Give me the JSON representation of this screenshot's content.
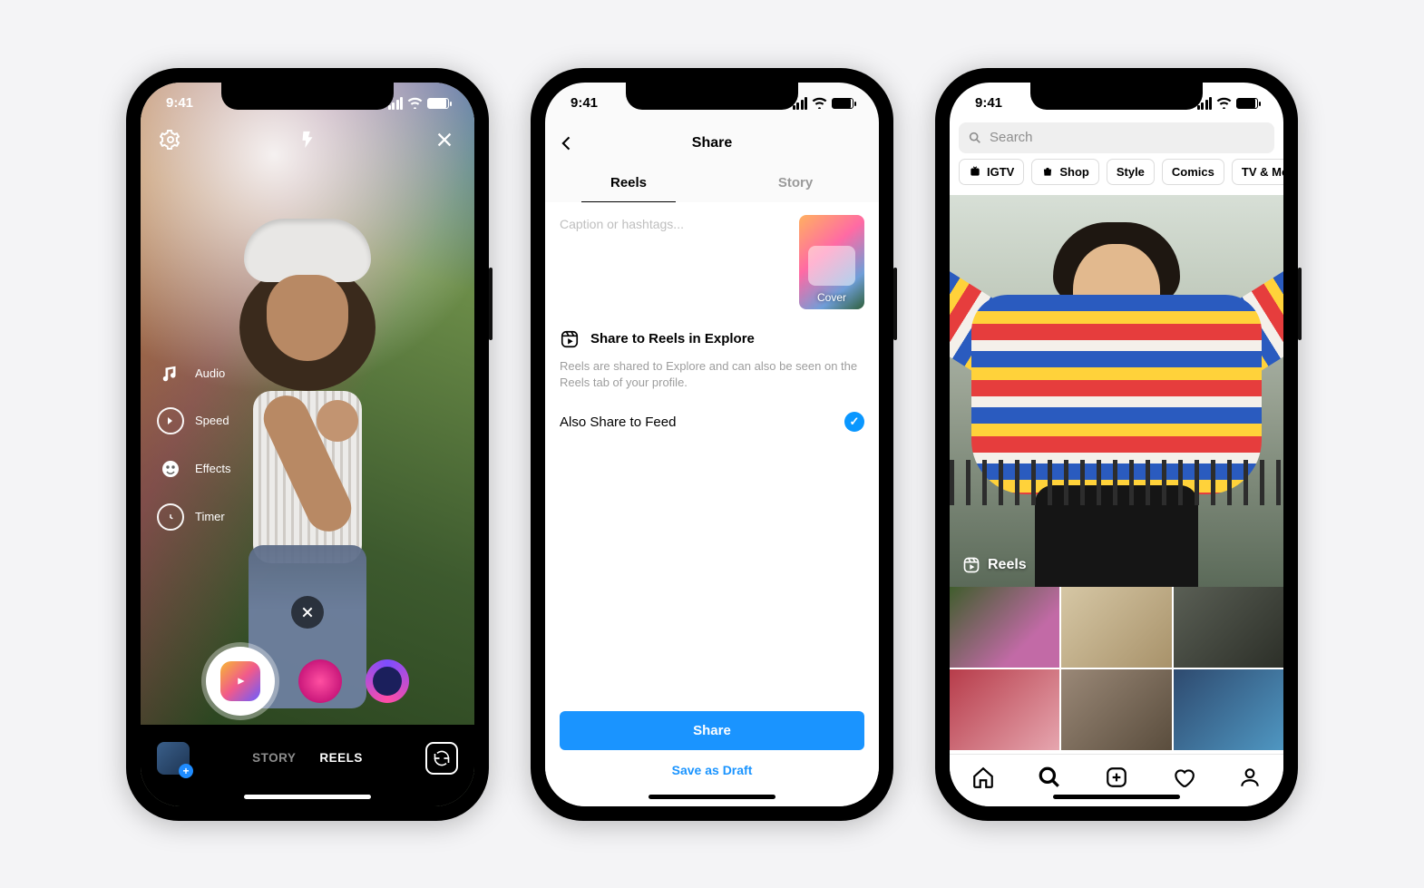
{
  "status": {
    "time": "9:41"
  },
  "phone1": {
    "tools": {
      "audio": "Audio",
      "speed": "Speed",
      "effects": "Effects",
      "timer": "Timer"
    },
    "modes": {
      "story": "STORY",
      "reels": "REELS"
    }
  },
  "phone2": {
    "header": {
      "title": "Share"
    },
    "tabs": {
      "reels": "Reels",
      "story": "Story"
    },
    "caption_placeholder": "Caption or hashtags...",
    "cover_label": "Cover",
    "share_reels_title": "Share to Reels in Explore",
    "share_reels_desc": "Reels are shared to Explore and can also be seen on the Reels tab of your profile.",
    "also_feed": "Also Share to Feed",
    "share_btn": "Share",
    "draft_btn": "Save as Draft"
  },
  "phone3": {
    "search_placeholder": "Search",
    "chips": {
      "igtv": "IGTV",
      "shop": "Shop",
      "style": "Style",
      "comics": "Comics",
      "tv": "TV & Movie"
    },
    "hero_tag": "Reels"
  }
}
